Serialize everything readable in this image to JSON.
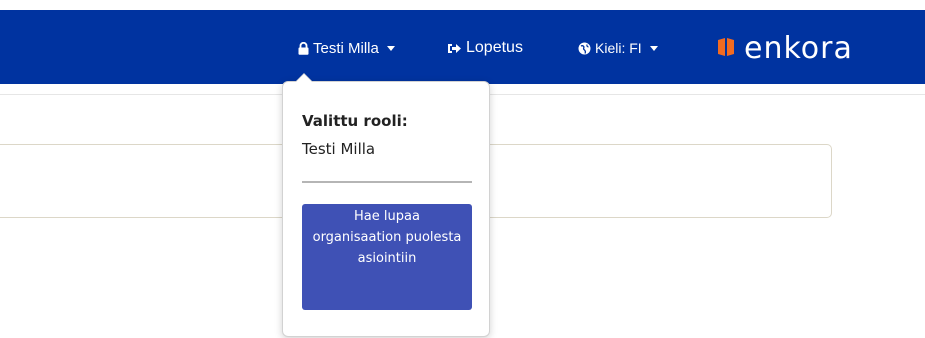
{
  "header": {
    "user_label": "Testi Milla",
    "logout_label": "Lopetus",
    "language_label": "Kieli: FI",
    "logo_text": "enkora",
    "brand_color": "#0033a0",
    "logo_accent_color": "#f26b21",
    "icons": {
      "user": "lock-icon",
      "logout": "sign-out-icon",
      "language": "globe-icon",
      "menu": "caret-down-icon"
    }
  },
  "role_menu": {
    "heading": "Valittu rooli:",
    "current_role": "Testi Milla",
    "org_button_label": "Hae lupaa organisaation puolesta asiointiin",
    "button_color": "#3f51b5"
  }
}
